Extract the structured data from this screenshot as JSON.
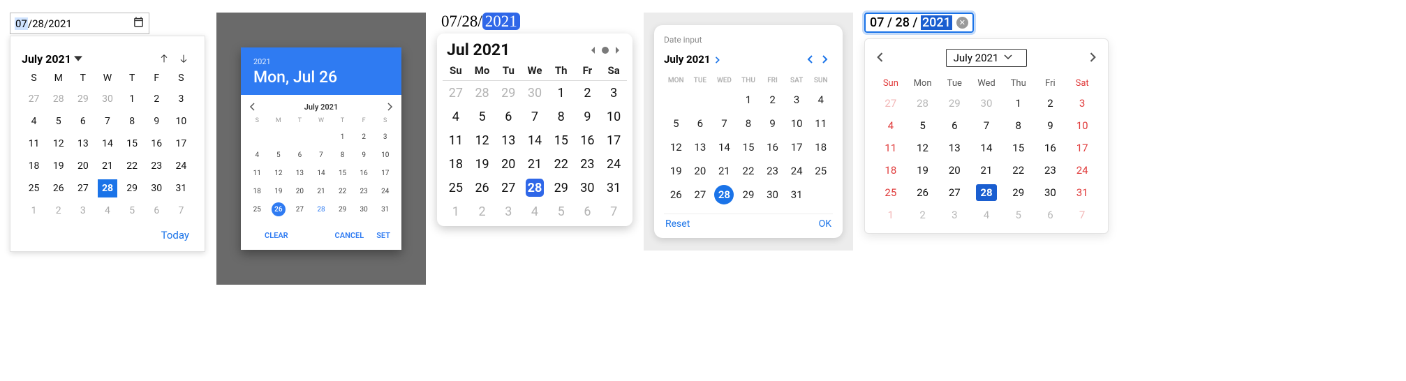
{
  "pickerA": {
    "input": {
      "mm": "07",
      "dd": "28",
      "yyyy": "2021",
      "sep": "/"
    },
    "header": {
      "month_label": "July 2021"
    },
    "day_headers": [
      "S",
      "M",
      "T",
      "W",
      "T",
      "F",
      "S"
    ],
    "weeks": [
      [
        {
          "n": 27,
          "m": true
        },
        {
          "n": 28,
          "m": true
        },
        {
          "n": 29,
          "m": true
        },
        {
          "n": 30,
          "m": true
        },
        {
          "n": 1
        },
        {
          "n": 2
        },
        {
          "n": 3
        }
      ],
      [
        {
          "n": 4
        },
        {
          "n": 5
        },
        {
          "n": 6
        },
        {
          "n": 7
        },
        {
          "n": 8
        },
        {
          "n": 9
        },
        {
          "n": 10
        }
      ],
      [
        {
          "n": 11
        },
        {
          "n": 12
        },
        {
          "n": 13
        },
        {
          "n": 14
        },
        {
          "n": 15
        },
        {
          "n": 16
        },
        {
          "n": 17
        }
      ],
      [
        {
          "n": 18
        },
        {
          "n": 19
        },
        {
          "n": 20
        },
        {
          "n": 21
        },
        {
          "n": 22
        },
        {
          "n": 23
        },
        {
          "n": 24
        }
      ],
      [
        {
          "n": 25
        },
        {
          "n": 26
        },
        {
          "n": 27
        },
        {
          "n": 28,
          "sel": true
        },
        {
          "n": 29
        },
        {
          "n": 30
        },
        {
          "n": 31
        }
      ],
      [
        {
          "n": 1,
          "m": true
        },
        {
          "n": 2,
          "m": true
        },
        {
          "n": 3,
          "m": true
        },
        {
          "n": 4,
          "m": true
        },
        {
          "n": 5,
          "m": true
        },
        {
          "n": 6,
          "m": true
        },
        {
          "n": 7,
          "m": true
        }
      ]
    ],
    "today_label": "Today"
  },
  "pickerB": {
    "hero_year": "2021",
    "hero_date": "Mon, Jul 26",
    "month_label": "July 2021",
    "day_headers": [
      "S",
      "M",
      "T",
      "W",
      "T",
      "F",
      "S"
    ],
    "weeks": [
      [
        {
          "n": null
        },
        {
          "n": null
        },
        {
          "n": null
        },
        {
          "n": null
        },
        {
          "n": 1
        },
        {
          "n": 2
        },
        {
          "n": 3
        }
      ],
      [
        {
          "n": 4
        },
        {
          "n": 5
        },
        {
          "n": 6
        },
        {
          "n": 7
        },
        {
          "n": 8
        },
        {
          "n": 9
        },
        {
          "n": 10
        }
      ],
      [
        {
          "n": 11
        },
        {
          "n": 12
        },
        {
          "n": 13
        },
        {
          "n": 14
        },
        {
          "n": 15
        },
        {
          "n": 16
        },
        {
          "n": 17
        }
      ],
      [
        {
          "n": 18
        },
        {
          "n": 19
        },
        {
          "n": 20
        },
        {
          "n": 21
        },
        {
          "n": 22
        },
        {
          "n": 23
        },
        {
          "n": 24
        }
      ],
      [
        {
          "n": 25
        },
        {
          "n": 26,
          "sel": true
        },
        {
          "n": 27
        },
        {
          "n": 28,
          "blue": true
        },
        {
          "n": 29
        },
        {
          "n": 30
        },
        {
          "n": 31
        }
      ]
    ],
    "actions": {
      "clear": "CLEAR",
      "cancel": "CANCEL",
      "set": "SET"
    }
  },
  "pickerC": {
    "input": {
      "mm": "07",
      "dd": "28",
      "yyyy": "2021",
      "sep": "/"
    },
    "title": "Jul 2021",
    "day_headers": [
      "Su",
      "Mo",
      "Tu",
      "We",
      "Th",
      "Fr",
      "Sa"
    ],
    "weeks": [
      [
        {
          "n": 27,
          "m": true
        },
        {
          "n": 28,
          "m": true
        },
        {
          "n": 29,
          "m": true
        },
        {
          "n": 30,
          "m": true
        },
        {
          "n": 1
        },
        {
          "n": 2
        },
        {
          "n": 3
        }
      ],
      [
        {
          "n": 4
        },
        {
          "n": 5
        },
        {
          "n": 6
        },
        {
          "n": 7
        },
        {
          "n": 8
        },
        {
          "n": 9
        },
        {
          "n": 10
        }
      ],
      [
        {
          "n": 11
        },
        {
          "n": 12
        },
        {
          "n": 13
        },
        {
          "n": 14
        },
        {
          "n": 15
        },
        {
          "n": 16
        },
        {
          "n": 17
        }
      ],
      [
        {
          "n": 18
        },
        {
          "n": 19
        },
        {
          "n": 20
        },
        {
          "n": 21
        },
        {
          "n": 22
        },
        {
          "n": 23
        },
        {
          "n": 24
        }
      ],
      [
        {
          "n": 25
        },
        {
          "n": 26
        },
        {
          "n": 27
        },
        {
          "n": 28,
          "sel": true
        },
        {
          "n": 29
        },
        {
          "n": 30
        },
        {
          "n": 31
        }
      ],
      [
        {
          "n": 1,
          "m": true
        },
        {
          "n": 2,
          "m": true
        },
        {
          "n": 3,
          "m": true
        },
        {
          "n": 4,
          "m": true
        },
        {
          "n": 5,
          "m": true
        },
        {
          "n": 6,
          "m": true
        },
        {
          "n": 7,
          "m": true
        }
      ]
    ]
  },
  "pickerD": {
    "label": "Date input",
    "month_label": "July 2021",
    "day_headers": [
      "MON",
      "TUE",
      "WED",
      "THU",
      "FRI",
      "SAT",
      "SUN"
    ],
    "weeks": [
      [
        {
          "n": null,
          "m": true
        },
        {
          "n": null,
          "m": true
        },
        {
          "n": null,
          "m": true
        },
        {
          "n": 1
        },
        {
          "n": 2
        },
        {
          "n": 3
        },
        {
          "n": 4
        }
      ],
      [
        {
          "n": 5
        },
        {
          "n": 6
        },
        {
          "n": 7
        },
        {
          "n": 8
        },
        {
          "n": 9
        },
        {
          "n": 10
        },
        {
          "n": 11
        }
      ],
      [
        {
          "n": 12
        },
        {
          "n": 13
        },
        {
          "n": 14
        },
        {
          "n": 15
        },
        {
          "n": 16
        },
        {
          "n": 17
        },
        {
          "n": 18
        }
      ],
      [
        {
          "n": 19
        },
        {
          "n": 20
        },
        {
          "n": 21
        },
        {
          "n": 22
        },
        {
          "n": 23
        },
        {
          "n": 24
        },
        {
          "n": 25
        }
      ],
      [
        {
          "n": 26
        },
        {
          "n": 27
        },
        {
          "n": 28,
          "sel": true
        },
        {
          "n": 29
        },
        {
          "n": 30
        },
        {
          "n": 31
        },
        {
          "n": null,
          "m": true
        }
      ]
    ],
    "actions": {
      "reset": "Reset",
      "ok": "OK"
    }
  },
  "pickerE": {
    "input": {
      "mm": "07",
      "dd": "28",
      "yyyy": "2021",
      "sep": "/"
    },
    "month_label": "July 2021",
    "day_headers": [
      "Sun",
      "Mon",
      "Tue",
      "Wed",
      "Thu",
      "Fri",
      "Sat"
    ],
    "weeks": [
      [
        {
          "n": 27,
          "m": true,
          "we": true
        },
        {
          "n": 28,
          "m": true
        },
        {
          "n": 29,
          "m": true
        },
        {
          "n": 30,
          "m": true
        },
        {
          "n": 1
        },
        {
          "n": 2
        },
        {
          "n": 3,
          "we": true
        }
      ],
      [
        {
          "n": 4,
          "we": true
        },
        {
          "n": 5
        },
        {
          "n": 6
        },
        {
          "n": 7
        },
        {
          "n": 8
        },
        {
          "n": 9
        },
        {
          "n": 10,
          "we": true
        }
      ],
      [
        {
          "n": 11,
          "we": true
        },
        {
          "n": 12
        },
        {
          "n": 13
        },
        {
          "n": 14
        },
        {
          "n": 15
        },
        {
          "n": 16
        },
        {
          "n": 17,
          "we": true
        }
      ],
      [
        {
          "n": 18,
          "we": true
        },
        {
          "n": 19
        },
        {
          "n": 20
        },
        {
          "n": 21
        },
        {
          "n": 22
        },
        {
          "n": 23
        },
        {
          "n": 24,
          "we": true
        }
      ],
      [
        {
          "n": 25,
          "we": true
        },
        {
          "n": 26
        },
        {
          "n": 27
        },
        {
          "n": 28,
          "sel": true
        },
        {
          "n": 29
        },
        {
          "n": 30
        },
        {
          "n": 31,
          "we": true
        }
      ],
      [
        {
          "n": 1,
          "m": true,
          "we": true
        },
        {
          "n": 2,
          "m": true
        },
        {
          "n": 3,
          "m": true
        },
        {
          "n": 4,
          "m": true
        },
        {
          "n": 5,
          "m": true
        },
        {
          "n": 6,
          "m": true
        },
        {
          "n": 7,
          "m": true,
          "we": true
        }
      ]
    ]
  },
  "chart_data": {
    "type": "table",
    "note": "not a chart"
  }
}
